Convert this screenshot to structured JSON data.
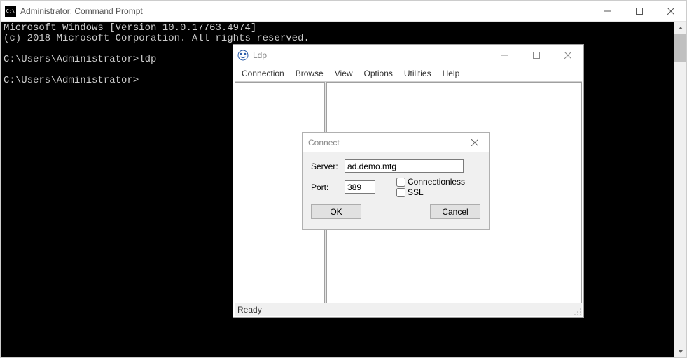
{
  "cmd": {
    "title": "Administrator: Command Prompt",
    "icon_label": "C:\\",
    "lines": "Microsoft Windows [Version 10.0.17763.4974]\n(c) 2018 Microsoft Corporation. All rights reserved.\n\nC:\\Users\\Administrator>ldp\n\nC:\\Users\\Administrator>"
  },
  "ldp": {
    "title": "Ldp",
    "menu": {
      "connection": "Connection",
      "browse": "Browse",
      "view": "View",
      "options": "Options",
      "utilities": "Utilities",
      "help": "Help"
    },
    "status": "Ready"
  },
  "dialog": {
    "title": "Connect",
    "server_label": "Server:",
    "server_value": "ad.demo.mtg",
    "port_label": "Port:",
    "port_value": "389",
    "connectionless_label": "Connectionless",
    "connectionless_checked": false,
    "ssl_label": "SSL",
    "ssl_checked": false,
    "ok_label": "OK",
    "cancel_label": "Cancel"
  }
}
